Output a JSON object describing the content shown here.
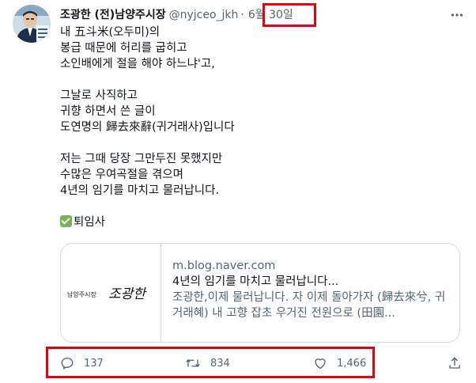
{
  "tweet": {
    "display_name": "조광한 (전)남양주시장",
    "handle": "@nyjceo_jkh",
    "separator": "·",
    "date": "6월 30일",
    "more_icon": "ellipsis-icon",
    "paragraphs": [
      "내 五斗米(오두미)의\n봉급 때문에 허리를 굽히고\n소인배에게 절을 해야 하느냐'고,",
      "그날로 사직하고\n귀향 하면서 쓴 글이\n도연명의 歸去來辭(귀거래사)입니다",
      "저는 그때 당장 그만두진 못했지만\n수많은 우여곡절을 겪으며\n4년의 임기를 마치고 물러납니다."
    ],
    "closing_emoji": "check-mark-emoji",
    "closing_text": "퇴임사"
  },
  "card": {
    "thumbnail_text": "남양주시장 조광한",
    "domain": "m.blog.naver.com",
    "title": "4년의 임기를 마치고 물러납니다...",
    "description": "조광한,이제 물러납니다. 자 이제 돌아가자 (歸去來兮, 귀거래혜) 내 고향 잡초 우거진 전원으로 (田園..."
  },
  "actions": {
    "reply_count": "137",
    "retweet_count": "834",
    "like_count": "1,466"
  },
  "colors": {
    "text_primary": "#0f1419",
    "text_secondary": "#536471",
    "card_border": "#cfd9de",
    "highlight_annotation": "#e3000f"
  }
}
